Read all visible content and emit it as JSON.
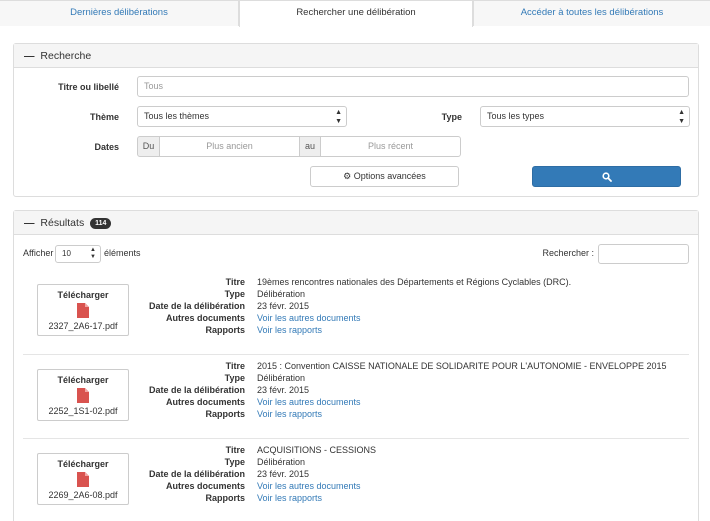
{
  "tabs": [
    {
      "label": "Dernières délibérations"
    },
    {
      "label": "Rechercher une délibération"
    },
    {
      "label": "Accéder à toutes les délibérations"
    }
  ],
  "search_panel": {
    "title": "Recherche",
    "titre_label": "Titre ou libellé",
    "titre_placeholder": "Tous",
    "theme_label": "Thème",
    "theme_value": "Tous les thèmes",
    "type_label": "Type",
    "type_value": "Tous les types",
    "dates_label": "Dates",
    "du_label": "Du",
    "du_placeholder": "Plus ancien",
    "au_label": "au",
    "au_placeholder": "Plus récent",
    "advanced_label": "Options avancées"
  },
  "results_panel": {
    "title": "Résultats",
    "count": "114",
    "show_label": "Afficher",
    "show_value": "10",
    "show_suffix": "éléments",
    "search_label": "Rechercher :"
  },
  "meta_labels": {
    "titre": "Titre",
    "type": "Type",
    "date": "Date de la délibération",
    "autres": "Autres documents",
    "rapports": "Rapports"
  },
  "results": [
    {
      "download_label": "Télécharger",
      "file": "2327_2A6-17.pdf",
      "titre": "19èmes rencontres nationales des Départements et Régions Cyclables (DRC).",
      "type": "Délibération",
      "date": "23 févr. 2015",
      "autres": "Voir les autres documents",
      "rapports": "Voir les rapports"
    },
    {
      "download_label": "Télécharger",
      "file": "2252_1S1-02.pdf",
      "titre": "2015 : Convention CAISSE NATIONALE DE SOLIDARITE POUR L'AUTONOMIE - ENVELOPPE 2015",
      "type": "Délibération",
      "date": "23 févr. 2015",
      "autres": "Voir les autres documents",
      "rapports": "Voir les rapports"
    },
    {
      "download_label": "Télécharger",
      "file": "2269_2A6-08.pdf",
      "titre": "ACQUISITIONS - CESSIONS",
      "type": "Délibération",
      "date": "23 févr. 2015",
      "autres": "Voir les autres documents",
      "rapports": "Voir les rapports"
    }
  ],
  "colors": {
    "primary": "#337ab7",
    "pdf_red": "#d9534f"
  }
}
